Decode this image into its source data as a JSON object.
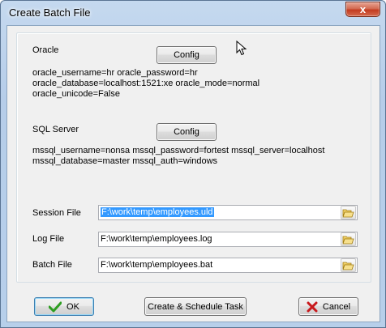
{
  "window": {
    "title": "Create Batch File",
    "close_label": "x"
  },
  "oracle": {
    "label": "Oracle",
    "config_label": "Config",
    "lines": [
      " oracle_username=hr oracle_password=hr",
      "oracle_database=localhost:1521:xe oracle_mode=normal",
      "oracle_unicode=False"
    ]
  },
  "sqlserver": {
    "label": "SQL Server",
    "config_label": "Config",
    "lines": [
      " mssql_username=nonsa mssql_password=fortest mssql_server=localhost",
      "mssql_database=master mssql_auth=windows"
    ]
  },
  "files": {
    "session_label": "Session File",
    "session_value": "F:\\work\\temp\\employees.uld",
    "log_label": "Log File",
    "log_value": "F:\\work\\temp\\employees.log",
    "batch_label": "Batch File",
    "batch_value": "F:\\work\\temp\\employees.bat"
  },
  "buttons": {
    "ok_label": "OK",
    "schedule_label": "Create & Schedule Task",
    "cancel_label": "Cancel"
  },
  "icons": {
    "ok": "check-icon",
    "cancel": "x-icon",
    "browse": "folder-icon",
    "cursor": "mouse-pointer-icon"
  },
  "colors": {
    "selection": "#3399ff",
    "check_green": "#2e9e22",
    "cancel_red": "#c8191c"
  }
}
